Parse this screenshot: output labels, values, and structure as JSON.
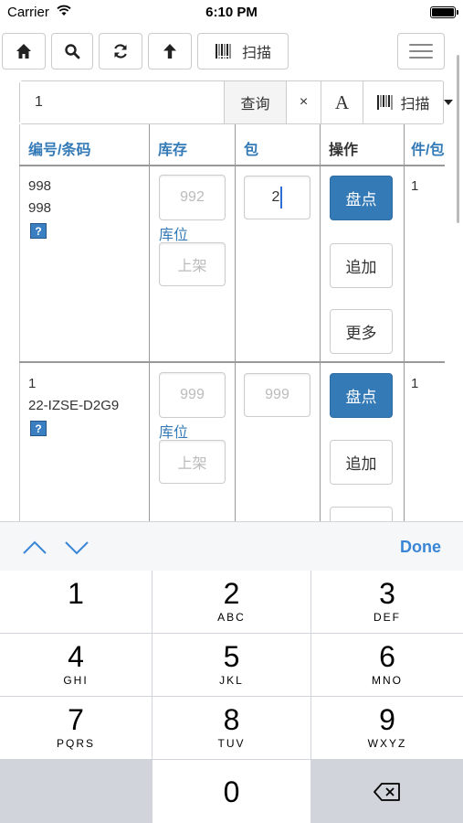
{
  "status_bar": {
    "carrier": "Carrier",
    "time": "6:10 PM"
  },
  "toolbar": {
    "scan_label": "扫描"
  },
  "search": {
    "value": "1",
    "query_label": "查询",
    "clear_label": "×",
    "font_label": "A",
    "scan_label": "扫描"
  },
  "table": {
    "headers": [
      "编号/条码",
      "库存",
      "包",
      "操作",
      "件/包"
    ],
    "location_label": "库位",
    "rows": [
      {
        "code_line1": "998",
        "code_line2": "998",
        "help_badge": "?",
        "stock_value": "992",
        "location_placeholder": "上架",
        "pack_value": "2",
        "btn_count": "盘点",
        "btn_append": "追加",
        "btn_more": "更多",
        "per_pack": "1"
      },
      {
        "code_line1": "1",
        "code_line2": "22-IZSE-D2G9",
        "help_badge": "?",
        "stock_value": "999",
        "location_placeholder": "上架",
        "pack_value": "999",
        "btn_count": "盘点",
        "btn_append": "追加",
        "per_pack": "1"
      }
    ]
  },
  "keyboard": {
    "done_label": "Done",
    "keys": [
      {
        "digit": "1",
        "letters": ""
      },
      {
        "digit": "2",
        "letters": "ABC"
      },
      {
        "digit": "3",
        "letters": "DEF"
      },
      {
        "digit": "4",
        "letters": "GHI"
      },
      {
        "digit": "5",
        "letters": "JKL"
      },
      {
        "digit": "6",
        "letters": "MNO"
      },
      {
        "digit": "7",
        "letters": "PQRS"
      },
      {
        "digit": "8",
        "letters": "TUV"
      },
      {
        "digit": "9",
        "letters": "WXYZ"
      },
      {
        "digit": "0",
        "letters": ""
      }
    ]
  },
  "colors": {
    "accent": "#337ab7",
    "done": "#3a86d6",
    "keyboard_bg": "#d1d5db"
  }
}
